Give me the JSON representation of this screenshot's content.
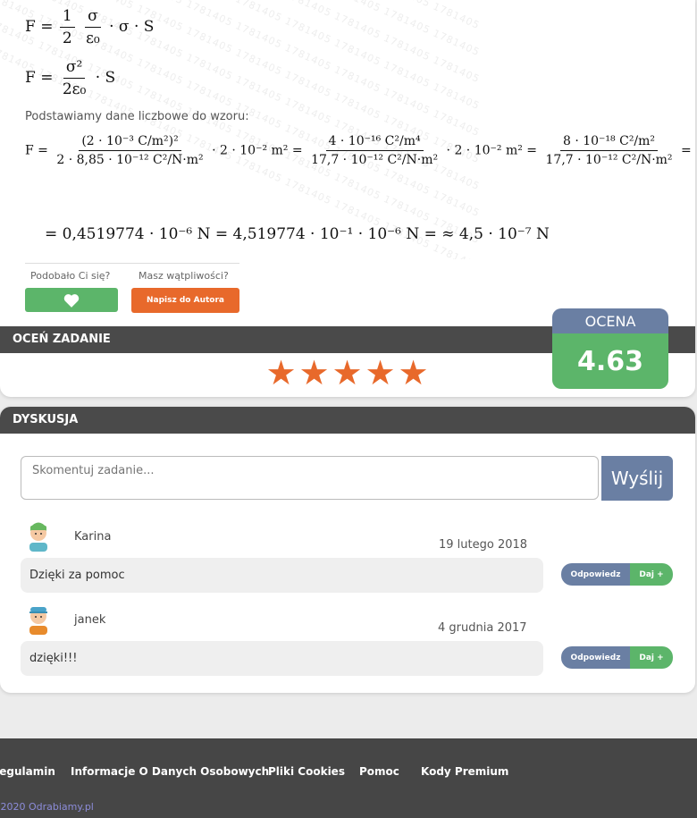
{
  "watermark": "1781405 1781405 1781405 1781405 1781405 1781405 1781405 1781405 1781405 1781405 1781405 1781405",
  "solution": {
    "eq1": {
      "lhs": "F =",
      "half_num": "1",
      "half_den": "2",
      "sig_num": "σ",
      "sig_den": "ε₀",
      "rest": "· σ · S"
    },
    "eq2": {
      "lhs": "F =",
      "num": "σ²",
      "den": "2ε₀",
      "rest": "· S"
    },
    "intro": "Podstawiamy dane liczbowe do wzoru:",
    "eq3": {
      "lhs": "F =",
      "a_num": "(2 · 10⁻³ C/m²)²",
      "a_den": "2 · 8,85 · 10⁻¹² C²/N·m²",
      "a_mul": "· 2 · 10⁻² m² =",
      "b_num": "4 · 10⁻¹⁶ C²/m⁴",
      "b_den": "17,7 · 10⁻¹² C²/N·m²",
      "b_mul": "· 2 · 10⁻² m² =",
      "c_num": "8 · 10⁻¹⁸ C²/m²",
      "c_den": "17,7 · 10⁻¹² C²/N·m²",
      "c_end": "="
    },
    "eq4": "= 0,4519774 · 10⁻⁶ N = 4,519774 · 10⁻¹ · 10⁻⁶ N = ≈ 4,5 · 10⁻⁷ N"
  },
  "feedback": {
    "like_label": "Podobało Ci się?",
    "doubt_label": "Masz wątpliwości?",
    "like_icon": "heart-icon",
    "author_button": "Napisz do Autora"
  },
  "rating": {
    "title": "OCEŃ ZADANIE",
    "stars": 5,
    "grade_label": "OCENA",
    "grade_value": "4.63",
    "star_color": "#e8692b"
  },
  "discussion": {
    "title": "DYSKUSJA",
    "input_placeholder": "Skomentuj zadanie...",
    "send_label": "Wyślij",
    "comments": [
      {
        "user": "Karina",
        "date": "19 lutego 2018",
        "text": "Dzięki za pomoc",
        "reply": "Odpowiedz",
        "give": "Daj +"
      },
      {
        "user": "janek",
        "date": "4 grudnia 2017",
        "text": "dzięki!!!",
        "reply": "Odpowiedz",
        "give": "Daj +"
      }
    ]
  },
  "footer": {
    "links": [
      "Regulamin",
      "Informacje O Danych Osobowych",
      "Pliki Cookies",
      "Pomoc",
      "Kody Premium"
    ],
    "copyright": "© 2020 Odrabiamy.pl"
  },
  "colors": {
    "green": "#5cb56a",
    "blue": "#6a7fa3",
    "orange": "#e8692b",
    "dark": "#4a4a4a"
  }
}
